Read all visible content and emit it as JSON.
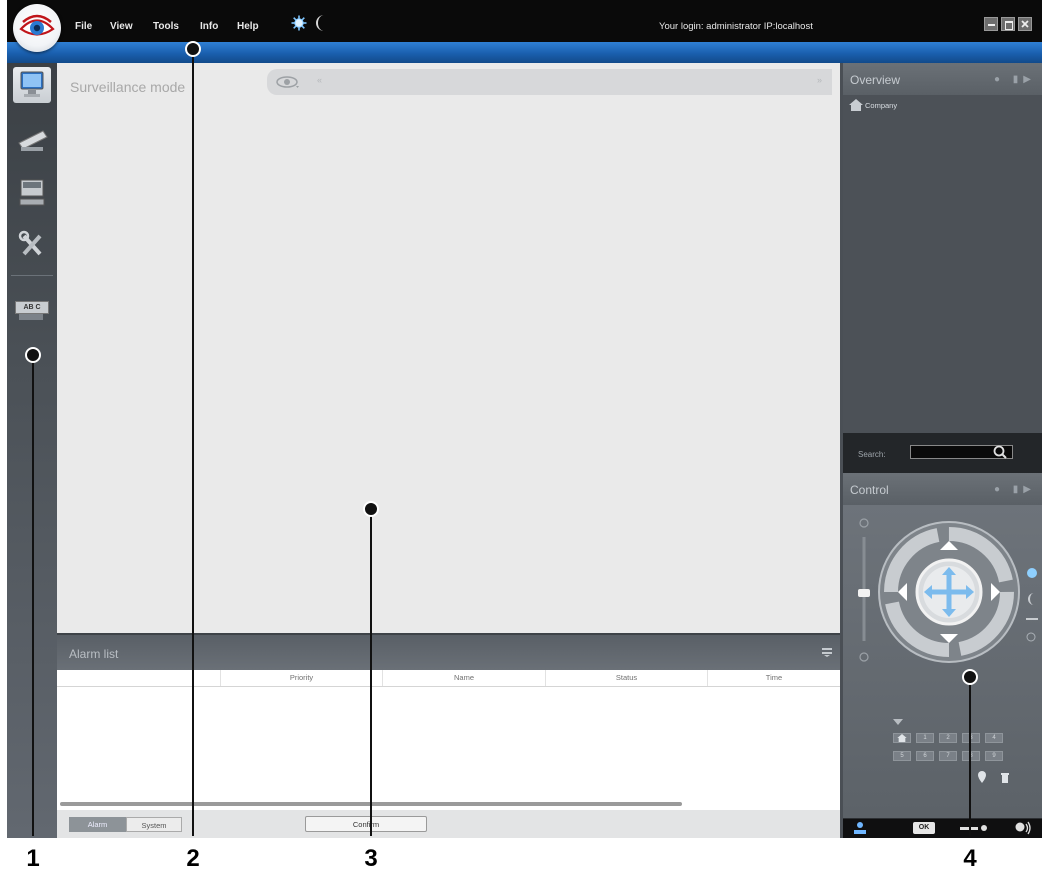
{
  "menu": {
    "file": "File",
    "view": "View",
    "tools": "Tools",
    "info": "Info",
    "help": "Help"
  },
  "header": {
    "login_info": "Your login: administrator  IP:localhost"
  },
  "main": {
    "mode_title": "Surveillance mode"
  },
  "sidebar": {
    "badge_label": "AB C"
  },
  "alarm_list": {
    "title": "Alarm list",
    "columns": [
      "",
      "Priority",
      "Name",
      "Status",
      "Time"
    ],
    "tabs": [
      "Alarm",
      "System"
    ],
    "confirm_label": "Confirm"
  },
  "overview": {
    "title": "Overview",
    "tree_root": "Company",
    "search_label": "Search:"
  },
  "control": {
    "title": "Control",
    "keypad": [
      "1",
      "2",
      "3",
      "4",
      "5",
      "6",
      "7",
      "8",
      "9"
    ],
    "ok_label": "OK"
  },
  "callouts": [
    "1",
    "2",
    "3",
    "4"
  ],
  "colors": {
    "title_bar": "#0a0a0a",
    "blue_bar": "#1f6cc2",
    "panel": "#4c5157",
    "main_bg": "#eaeaea"
  }
}
